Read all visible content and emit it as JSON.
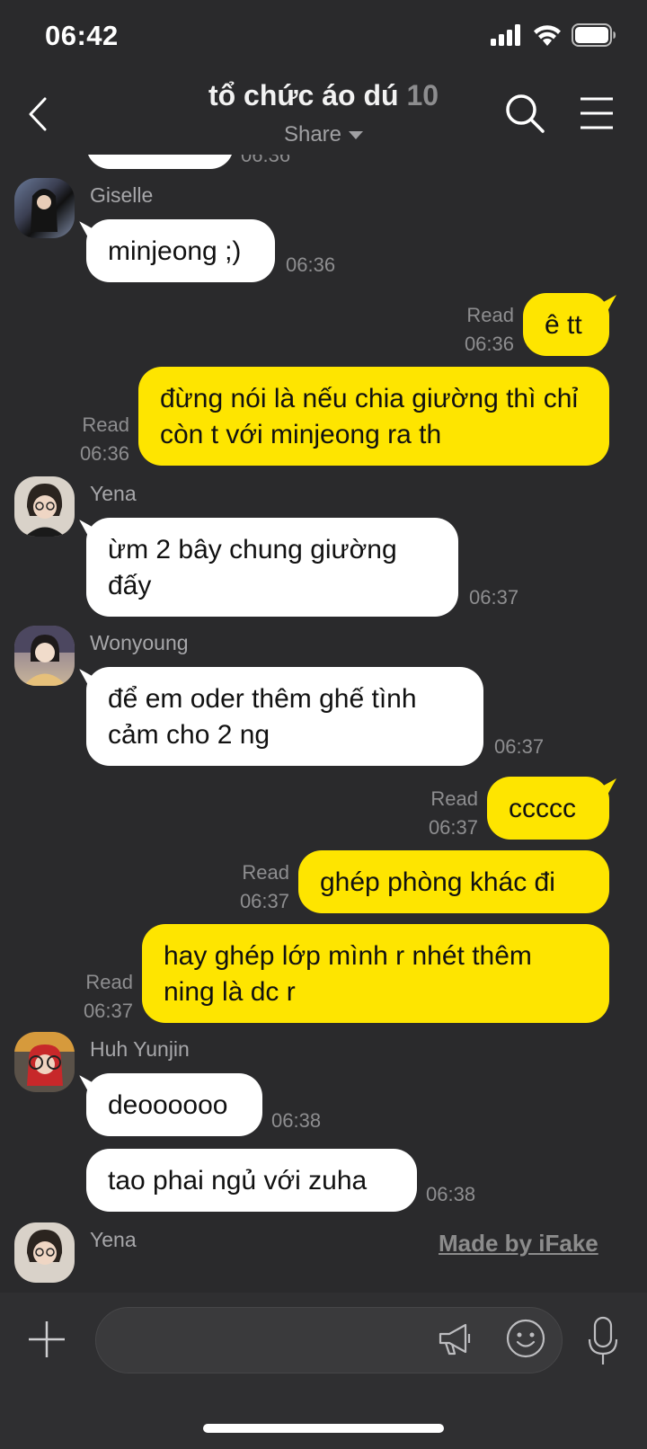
{
  "status_bar": {
    "time": "06:42"
  },
  "header": {
    "title": "tổ chức áo dú",
    "member_count": "10",
    "subtitle": "Share"
  },
  "messages": [
    {
      "sender": "Giselle",
      "text": "minjeong ;)",
      "time": "06:36"
    },
    {
      "text": "ê tt",
      "read": "Read",
      "time": "06:36"
    },
    {
      "text": "đừng nói là nếu chia giường thì chỉ còn t với minjeong ra th",
      "read": "Read",
      "time": "06:36"
    },
    {
      "sender": "Yena",
      "text": "ừm 2 bây chung giường đấy",
      "time": "06:37"
    },
    {
      "sender": "Wonyoung",
      "text": "để em oder thêm ghế tình cảm cho 2 ng",
      "time": "06:37"
    },
    {
      "text": "ccccc",
      "read": "Read",
      "time": "06:37"
    },
    {
      "text": "ghép phòng khác đi",
      "read": "Read",
      "time": "06:37"
    },
    {
      "text": "hay ghép lớp mình r nhét thêm ning là dc r",
      "read": "Read",
      "time": "06:37"
    },
    {
      "sender": "Huh Yunjin",
      "text": "deoooooo",
      "time": "06:38"
    },
    {
      "text": "tao phai ngủ với zuha",
      "time": "06:38"
    },
    {
      "sender": "Yena"
    }
  ],
  "top_partial_time": "06:36",
  "input_bar": {
    "placeholder": ""
  },
  "watermark": "Made by iFake",
  "icons": [
    "back-icon",
    "search-icon",
    "menu-icon",
    "plus-icon",
    "megaphone-icon",
    "emoji-icon",
    "mic-icon",
    "signal-icon",
    "wifi-icon",
    "battery-icon"
  ],
  "colors": {
    "background": "#2a2a2c",
    "outgoing_bubble": "#fee500",
    "incoming_bubble": "#ffffff"
  }
}
